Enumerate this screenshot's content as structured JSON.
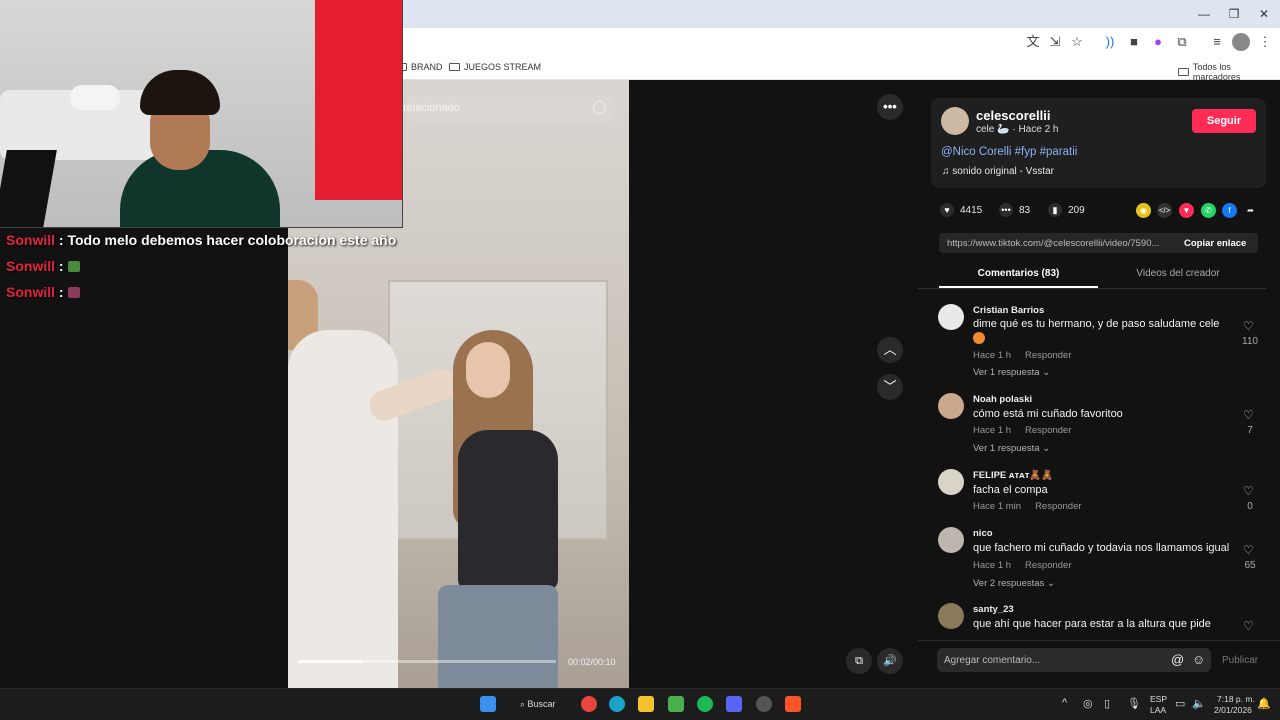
{
  "bookmarks": [
    {
      "label": "BRAND"
    },
    {
      "label": "JUEGOS STREAM"
    },
    {
      "label": "Todos los marcadores"
    }
  ],
  "video": {
    "search_placeholder": "relacionado",
    "time": "00:02/00:10",
    "progress": 0.25
  },
  "chat": [
    {
      "user": "Sonwill",
      "message": "Todo melo debemos hacer coloboracion este año"
    },
    {
      "user": "Sonwill",
      "message": ""
    },
    {
      "user": "Sonwill",
      "message": ""
    }
  ],
  "author": {
    "username": "celescorellii",
    "display": "cele 🦢 · Hace 2 h",
    "follow_label": "Seguir"
  },
  "caption": "@Nico Corelli #fyp #paratii",
  "sound": "sonido original - Vsstar",
  "stats": {
    "likes": "4415",
    "comments": "83",
    "saves": "209"
  },
  "link": {
    "url": "https://www.tiktok.com/@celescorellii/video/7590...",
    "copy_label": "Copiar enlace"
  },
  "tabs": [
    {
      "label": "Comentarios (83)"
    },
    {
      "label": "Videos del creador"
    }
  ],
  "comments": [
    {
      "name": "Cristian Barrios",
      "text": "dime qué es tu hermano, y de paso saludame cele",
      "time": "Hace 1 h",
      "reply": "Responder",
      "more": "Ver 1 respuesta",
      "likes": "110"
    },
    {
      "name": "Noah polaski",
      "text": "cómo está mi cuñado favoritoo",
      "time": "Hace 1 h",
      "reply": "Responder",
      "more": "Ver 1 respuesta",
      "likes": "7"
    },
    {
      "name": "FELIPE ᴀᴛᴀᴛ🧸🧸",
      "text": "facha el compa",
      "time": "Hace 1 min",
      "reply": "Responder",
      "likes": "0"
    },
    {
      "name": "nico",
      "text": "que fachero mi cuñado y todavia nos llamamos igual",
      "time": "Hace 1 h",
      "reply": "Responder",
      "more": "Ver 2 respuestas",
      "likes": "65"
    },
    {
      "name": "santy_23",
      "text": "que ahí que hacer para estar a la altura que pide"
    }
  ],
  "add_comment": {
    "placeholder": "Agregar comentario...",
    "publish_label": "Publicar"
  },
  "taskbar": {
    "search_label": "Buscar",
    "lang_top": "ESP",
    "lang_bottom": "LAA",
    "time": "7:18 p. m.",
    "date": "2/01/2026"
  },
  "colors": {
    "accent": "#fe2c55",
    "chat_user": "#e4233f",
    "caption_link": "#8ab4f8"
  }
}
